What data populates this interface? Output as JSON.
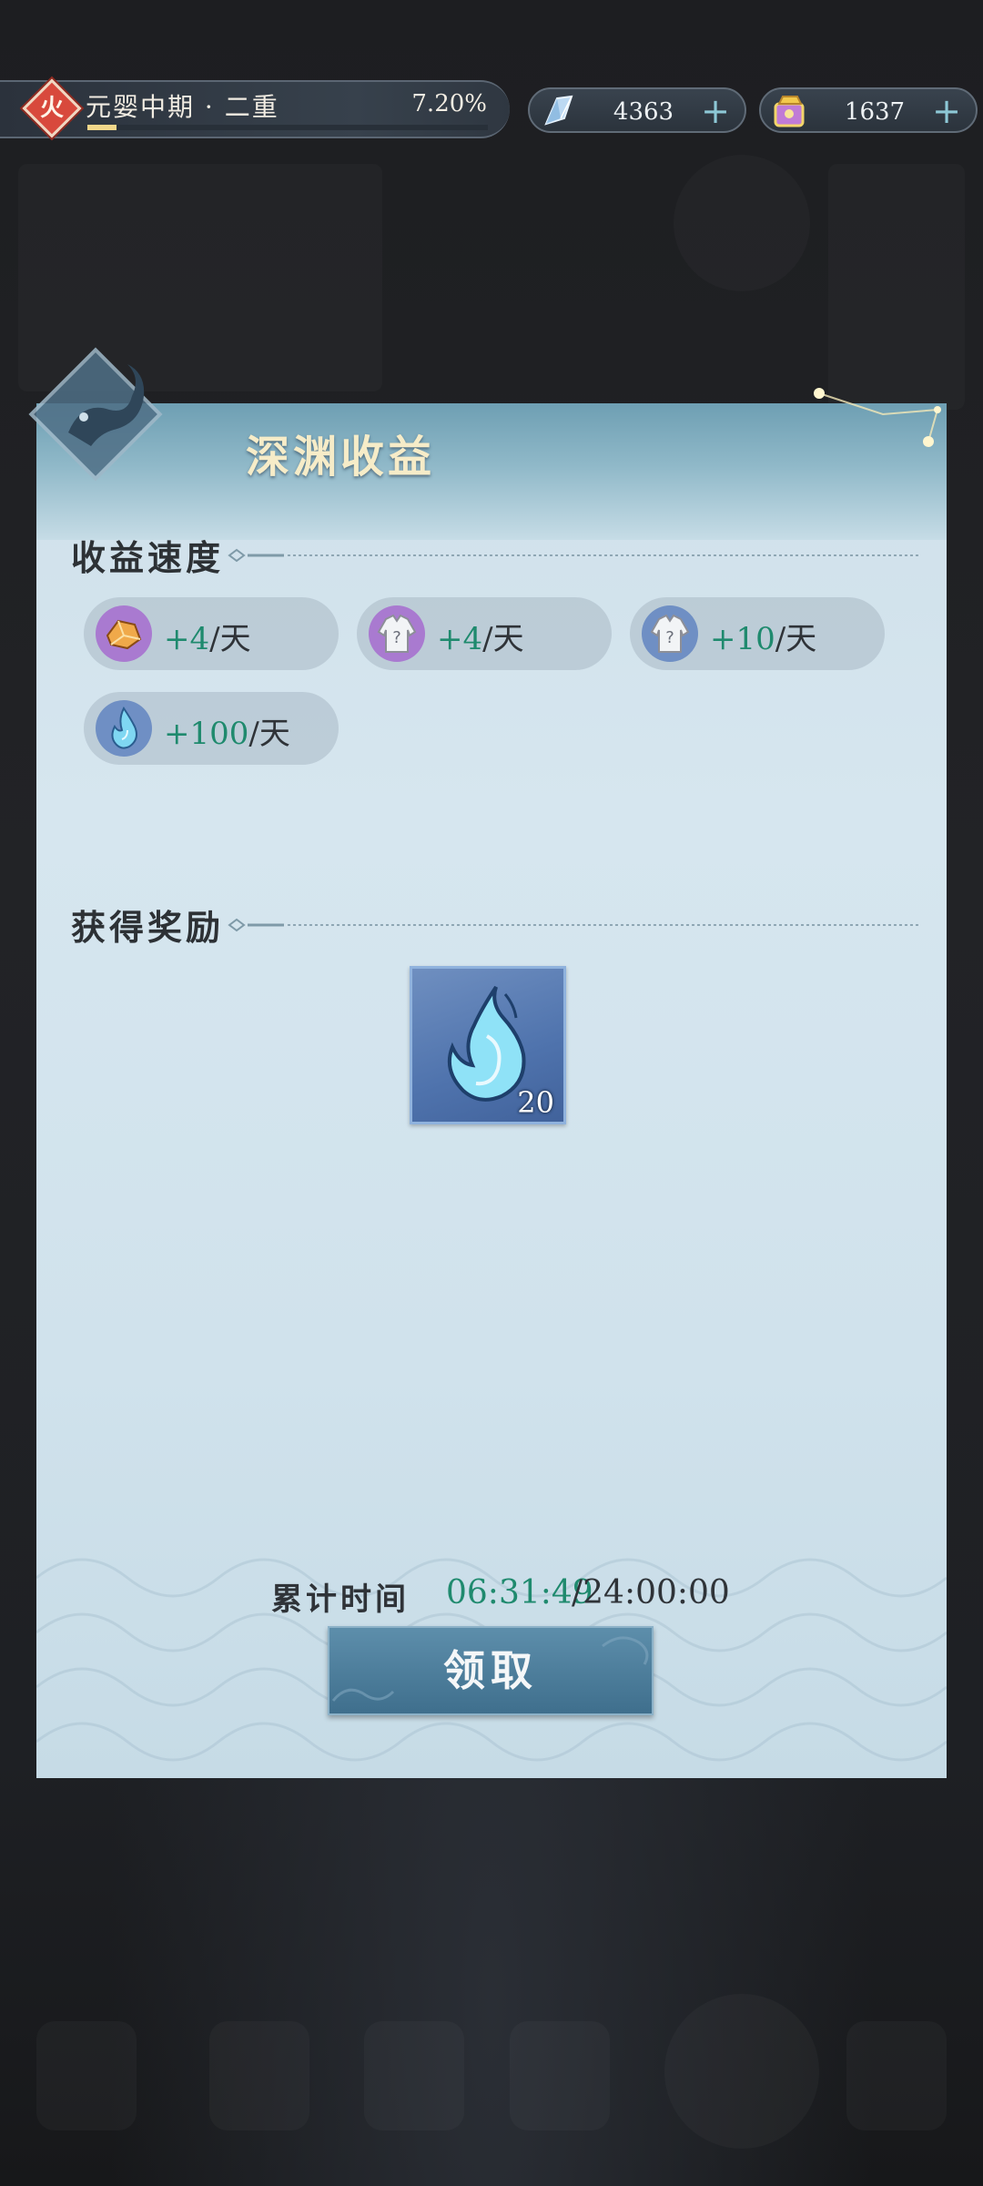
{
  "top_bar": {
    "element_badge": "火",
    "rank_name": "元婴中期 · 二重",
    "rank_progress_text": "7.20%",
    "rank_progress_fraction": 0.072,
    "resources": [
      {
        "icon": "spirit-crystal-icon",
        "value": "4363"
      },
      {
        "icon": "gold-token-icon",
        "value": "1637"
      }
    ]
  },
  "dialog": {
    "title": "深渊收益",
    "rate_section": {
      "title": "收益速度",
      "rates": [
        {
          "icon": "ore-material-icon",
          "amount": "+4",
          "unit": "/天"
        },
        {
          "icon": "mystery-robe-purple-icon",
          "amount": "+4",
          "unit": "/天"
        },
        {
          "icon": "mystery-robe-blue-icon",
          "amount": "+10",
          "unit": "/天"
        },
        {
          "icon": "blue-flame-icon",
          "amount": "+100",
          "unit": "/天"
        }
      ]
    },
    "reward_section": {
      "title": "获得奖励",
      "rewards": [
        {
          "icon": "blue-flame-icon",
          "count": "20"
        }
      ]
    },
    "timer": {
      "label": "累计时间",
      "current": "06:31:49",
      "total": "/24:00:00"
    },
    "claim_button": "领取"
  },
  "colors": {
    "accent_green": "#1f8a6e",
    "title_gold": "#f6ecc8",
    "button_blue": "#3f6f8d",
    "element_red": "#d8493c"
  }
}
